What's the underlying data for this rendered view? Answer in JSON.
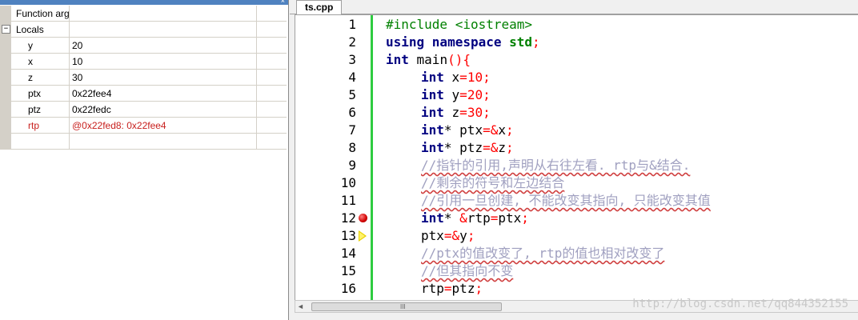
{
  "locals_panel": {
    "rows": [
      {
        "name": "Function arg",
        "value": "",
        "kind": "header"
      },
      {
        "name": "Locals",
        "value": "",
        "kind": "group"
      },
      {
        "name": "y",
        "value": "20",
        "kind": "child"
      },
      {
        "name": "x",
        "value": "10",
        "kind": "child"
      },
      {
        "name": "z",
        "value": "30",
        "kind": "child"
      },
      {
        "name": "ptx",
        "value": "0x22fee4",
        "kind": "child"
      },
      {
        "name": "ptz",
        "value": "0x22fedc",
        "kind": "child"
      },
      {
        "name": "rtp",
        "value": "@0x22fed8: 0x22fee4",
        "kind": "child-red"
      },
      {
        "name": "",
        "value": "",
        "kind": "empty"
      }
    ],
    "collapse_glyph": "⊟"
  },
  "editor": {
    "tab_label": "ts.cpp",
    "lines": [
      {
        "n": "1"
      },
      {
        "n": "2"
      },
      {
        "n": "3"
      },
      {
        "n": "4"
      },
      {
        "n": "5"
      },
      {
        "n": "6"
      },
      {
        "n": "7"
      },
      {
        "n": "8"
      },
      {
        "n": "9"
      },
      {
        "n": "10"
      },
      {
        "n": "11"
      },
      {
        "n": "12"
      },
      {
        "n": "13"
      },
      {
        "n": "14"
      },
      {
        "n": "15"
      },
      {
        "n": "16"
      }
    ],
    "code": {
      "l1_pp": "#include <iostream>",
      "l2_kw1": "using namespace",
      "l2_std": " std",
      "l2_semi": ";",
      "l3_kw": "int",
      "l3_rest": " main",
      "l3_op": "(){",
      "l4_kw": "int",
      "l4_a": " x",
      "l4_op": "=",
      "l4_num": "10",
      "l4_semi": ";",
      "l5_kw": "int",
      "l5_a": " y",
      "l5_op": "=",
      "l5_num": "20",
      "l5_semi": ";",
      "l6_kw": "int",
      "l6_a": " z",
      "l6_op": "=",
      "l6_num": "30",
      "l6_semi": ";",
      "l7_kw": "int",
      "l7_a": "* ptx",
      "l7_op": "=&",
      "l7_b": "x",
      "l7_semi": ";",
      "l8_kw": "int",
      "l8_a": "* ptz",
      "l8_op": "=&",
      "l8_b": "z",
      "l8_semi": ";",
      "l9_cmt": "//指针的引用,声明从右往左看. rtp与&结合.",
      "l10_cmt": "//剩余的符号和左边结合",
      "l11_cmt": "//引用一旦创建, 不能改变其指向, 只能改变其值",
      "l12_kw": "int",
      "l12_a": "* ",
      "l12_op1": "&",
      "l12_b": "rtp",
      "l12_op2": "=",
      "l12_c": "ptx",
      "l12_semi": ";",
      "l13_a": "ptx",
      "l13_op": "=&",
      "l13_b": "y",
      "l13_semi": ";",
      "l14_cmt": "//ptx的值改变了, rtp的值也相对改变了",
      "l15_cmt": "//但其指向不变",
      "l16_a": "rtp",
      "l16_op": "=",
      "l16_b": "ptz",
      "l16_semi": ";"
    },
    "breakpoint_line": "12",
    "current_line": "13",
    "scroll_grip": "III",
    "scroll_left": "◄"
  },
  "watermark": "http://blog.csdn.net/qq844352155"
}
